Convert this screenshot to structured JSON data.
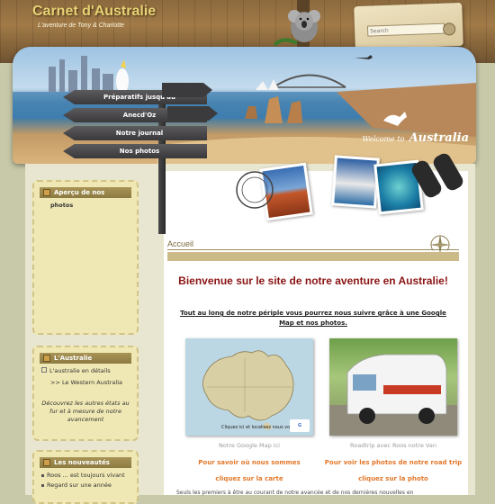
{
  "header": {
    "site_title": "Carnet d'Australie",
    "site_subtitle": "L'aventure de Tony & Charlotte",
    "search_placeholder": "Search"
  },
  "banner": {
    "welcome_small": "Welcome to",
    "welcome_big": "Australia"
  },
  "menu": {
    "items": [
      {
        "label": "Préparatifs jusqu'au"
      },
      {
        "label": "Anecd'Oz"
      },
      {
        "label": "Notre journal"
      },
      {
        "label": "Nos photos"
      }
    ]
  },
  "sidebar": {
    "photos_box": {
      "title": "Aperçu de nos",
      "subtitle": "photos"
    },
    "australia_box": {
      "title": "L'Australie",
      "item1": "L'australie en détails",
      "item2": ">> Le Western Australia",
      "note": "Découvrez les autres états au fur et à mesure de notre avancement"
    },
    "news_box": {
      "title": "Les nouveautés",
      "item1": "Roos ... est toujours vivant",
      "item2": "Regard sur une année"
    }
  },
  "main": {
    "breadcrumb": "Accueil",
    "headline": "Bienvenue sur le site de notre aventure en Australie!",
    "intro": "Tout au long de notre périple vous pourrez nous suivre grâce à une Google Map et nos photos.",
    "left_caption": "Notre Google Map ici",
    "left_link1": "Pour savoir où nous sommes",
    "left_link2": "cliquez sur la carte",
    "map_label": "Cliquez ici et localisez nous vous",
    "right_caption": "Roadtrip avec Roos notre Van",
    "right_link1": "Pour voir les photos de notre road trip",
    "right_link2": "cliquez sur la photo",
    "bottom_text": "Seuls les premiers à être au courant de notre avancée et de nos dernières nouvelles en"
  },
  "colors": {
    "accent_red": "#8a1414",
    "link_orange": "#e2782b",
    "sidebar_bg": "#f0e8b4",
    "page_bg": "#c8c9a9"
  }
}
